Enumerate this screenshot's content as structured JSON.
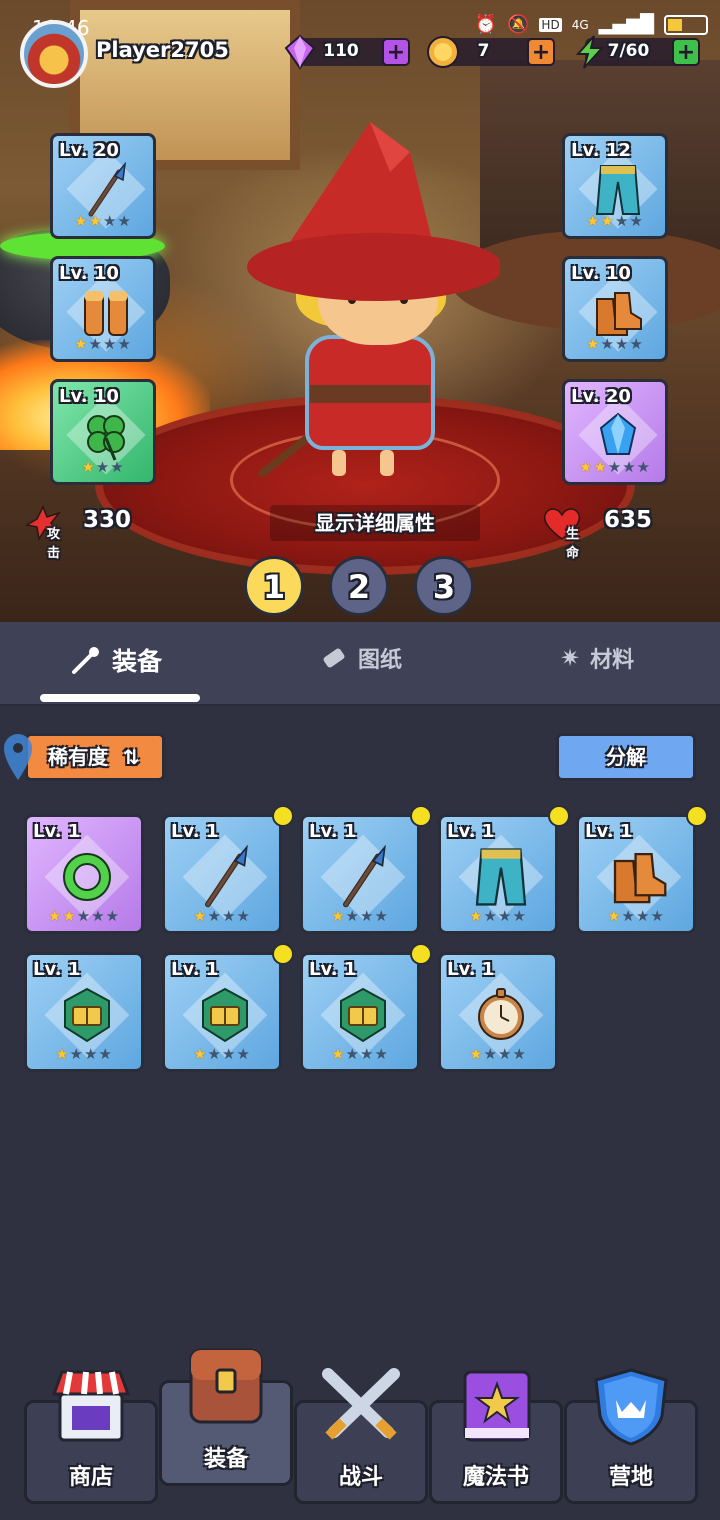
{
  "status_bar": {
    "time": "18:46",
    "network": "4G",
    "hd": "HD"
  },
  "player": {
    "name": "Player2705"
  },
  "resources": [
    {
      "name": "gems",
      "value": "110",
      "color": "#c864f0",
      "plus_color": "#b453e8"
    },
    {
      "name": "coins",
      "value": "7",
      "color": "#f2b13a",
      "plus_color": "#f08a32"
    },
    {
      "name": "energy",
      "value": "7/60",
      "color": "#5cd04a",
      "plus_color": "#3fc04a"
    }
  ],
  "equipped_left": [
    {
      "level": "Lv. 20",
      "rarity": "blue",
      "item": "spear",
      "stars": 2,
      "max_stars": 4
    },
    {
      "level": "Lv. 10",
      "rarity": "blue",
      "item": "gloves",
      "stars": 1,
      "max_stars": 4
    },
    {
      "level": "Lv. 10",
      "rarity": "green",
      "item": "clover",
      "stars": 1,
      "max_stars": 3
    }
  ],
  "equipped_right": [
    {
      "level": "Lv. 12",
      "rarity": "blue",
      "item": "pants",
      "stars": 2,
      "max_stars": 4
    },
    {
      "level": "Lv. 10",
      "rarity": "blue",
      "item": "boots",
      "stars": 1,
      "max_stars": 4
    },
    {
      "level": "Lv. 20",
      "rarity": "purple",
      "item": "crystal",
      "stars": 2,
      "max_stars": 5
    }
  ],
  "stats": {
    "attack_label": "攻击",
    "attack_value": "330",
    "hp_label": "生命",
    "hp_value": "635",
    "detail_label": "显示详细属性"
  },
  "loadout_pages": [
    "1",
    "2",
    "3"
  ],
  "active_page": 0,
  "tabs": [
    {
      "label": "装备",
      "active": true
    },
    {
      "label": "图纸",
      "active": false
    },
    {
      "label": "材料",
      "active": false
    }
  ],
  "filters": {
    "rarity_label": "稀有度",
    "sort_icon": "⇅",
    "split_label": "分解"
  },
  "inventory": [
    {
      "level": "Lv. 1",
      "rarity": "purple",
      "item": "ring",
      "stars": 2,
      "max_stars": 5,
      "new": false
    },
    {
      "level": "Lv. 1",
      "rarity": "blue",
      "item": "spear",
      "stars": 1,
      "max_stars": 4,
      "new": true
    },
    {
      "level": "Lv. 1",
      "rarity": "blue",
      "item": "spear",
      "stars": 1,
      "max_stars": 4,
      "new": true
    },
    {
      "level": "Lv. 1",
      "rarity": "blue",
      "item": "pants",
      "stars": 1,
      "max_stars": 4,
      "new": true
    },
    {
      "level": "Lv. 1",
      "rarity": "blue",
      "item": "boots",
      "stars": 1,
      "max_stars": 4,
      "new": true
    },
    {
      "level": "Lv. 1",
      "rarity": "blue",
      "item": "book-emblem",
      "stars": 1,
      "max_stars": 4,
      "new": false
    },
    {
      "level": "Lv. 1",
      "rarity": "blue",
      "item": "book-emblem",
      "stars": 1,
      "max_stars": 4,
      "new": true
    },
    {
      "level": "Lv. 1",
      "rarity": "blue",
      "item": "book-emblem",
      "stars": 1,
      "max_stars": 4,
      "new": true
    },
    {
      "level": "Lv. 1",
      "rarity": "blue",
      "item": "pocket-watch",
      "stars": 1,
      "max_stars": 4,
      "new": false
    }
  ],
  "nav": [
    {
      "label": "商店",
      "icon": "shop-icon",
      "active": false
    },
    {
      "label": "装备",
      "icon": "backpack-icon",
      "active": true
    },
    {
      "label": "战斗",
      "icon": "crossed-swords-icon",
      "active": false
    },
    {
      "label": "魔法书",
      "icon": "spellbook-icon",
      "active": false
    },
    {
      "label": "营地",
      "icon": "shield-crown-icon",
      "active": false
    }
  ]
}
